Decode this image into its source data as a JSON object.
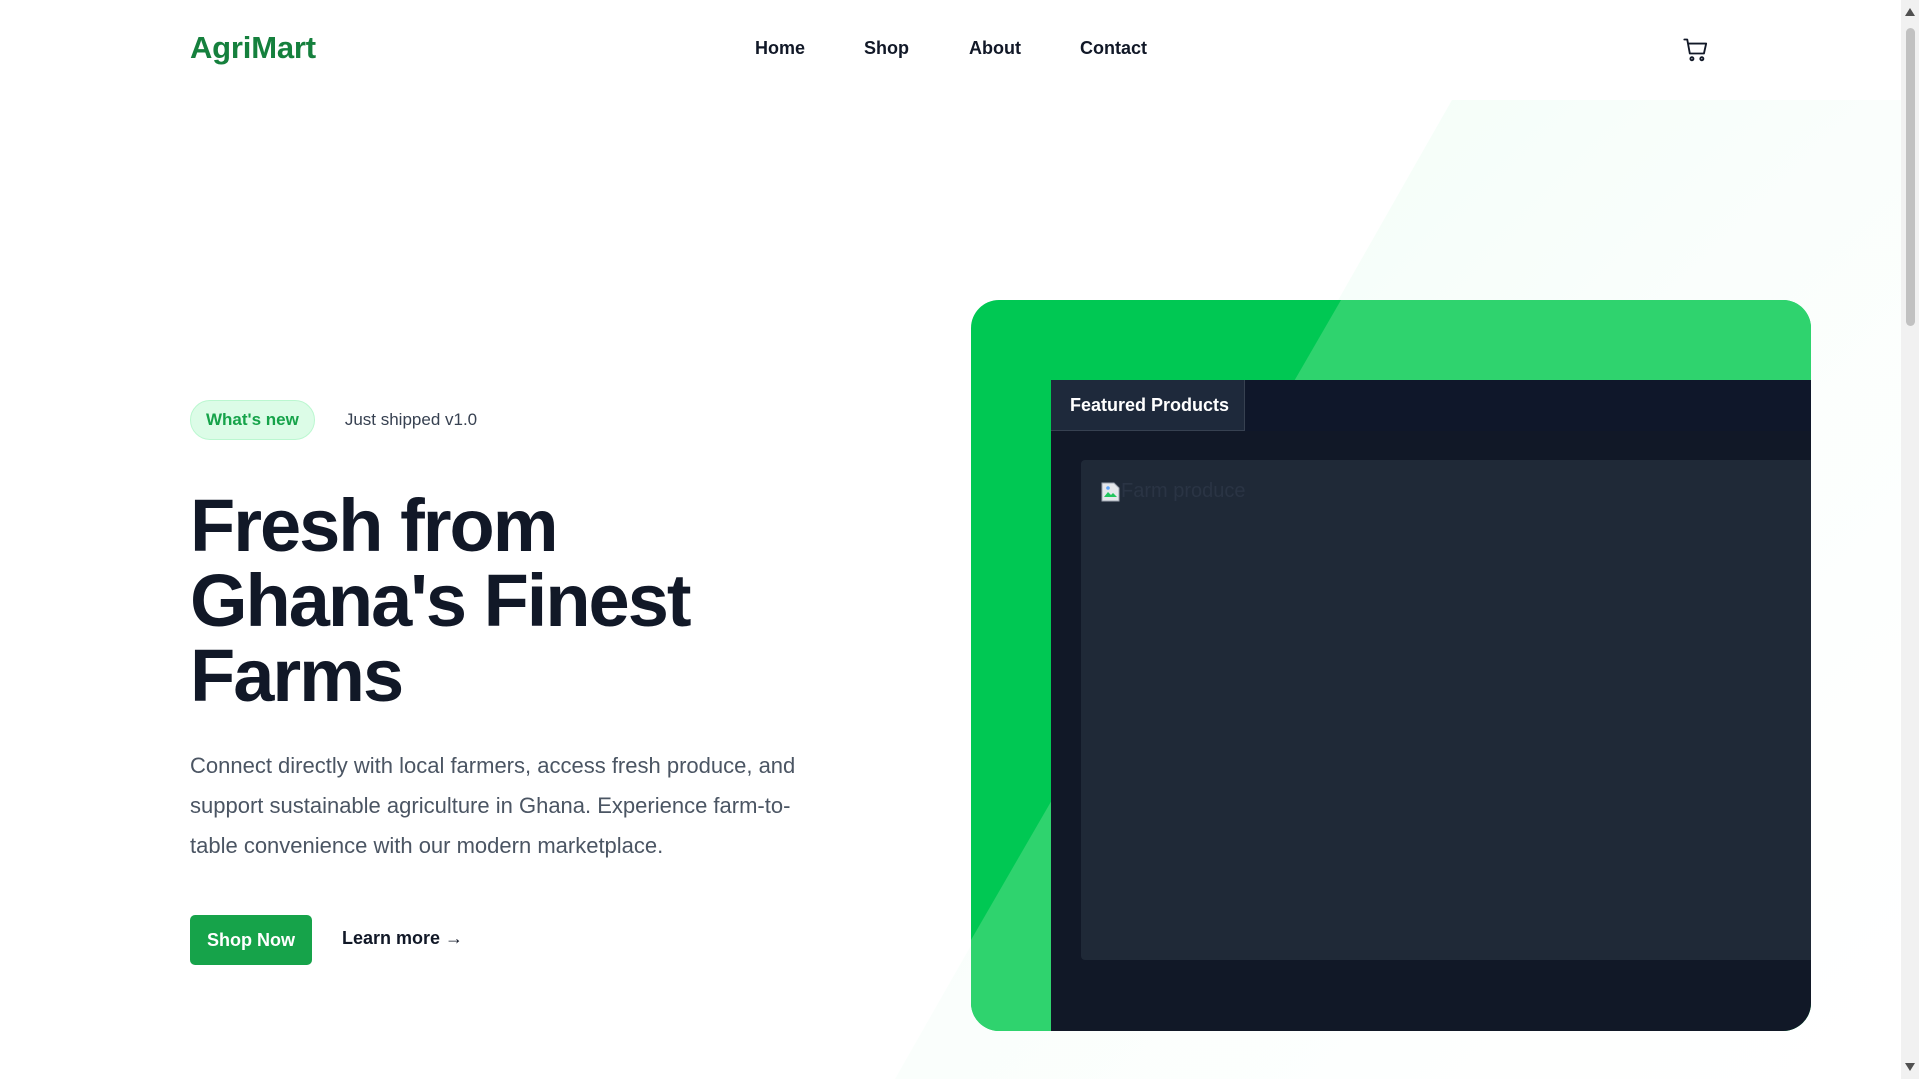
{
  "header": {
    "logo": "AgriMart",
    "nav": [
      {
        "label": "Home"
      },
      {
        "label": "Shop"
      },
      {
        "label": "About"
      },
      {
        "label": "Contact"
      }
    ],
    "cart_icon": "cart-icon"
  },
  "hero": {
    "badge": "What's new",
    "badge_text": "Just shipped v1.0",
    "title": "Fresh from Ghana's Finest Farms",
    "description": "Connect directly with local farmers, access fresh produce, and support sustainable agriculture in Ghana. Experience farm-to-table convenience with our modern marketplace.",
    "primary_button": "Shop Now",
    "secondary_link": "Learn more →"
  },
  "showcase": {
    "tab": "Featured Products",
    "image_alt": "Farm produce"
  },
  "colors": {
    "brand": "#15803d",
    "button": "#16a34a",
    "showcase_green": "#00c853",
    "dark": "#111827"
  }
}
